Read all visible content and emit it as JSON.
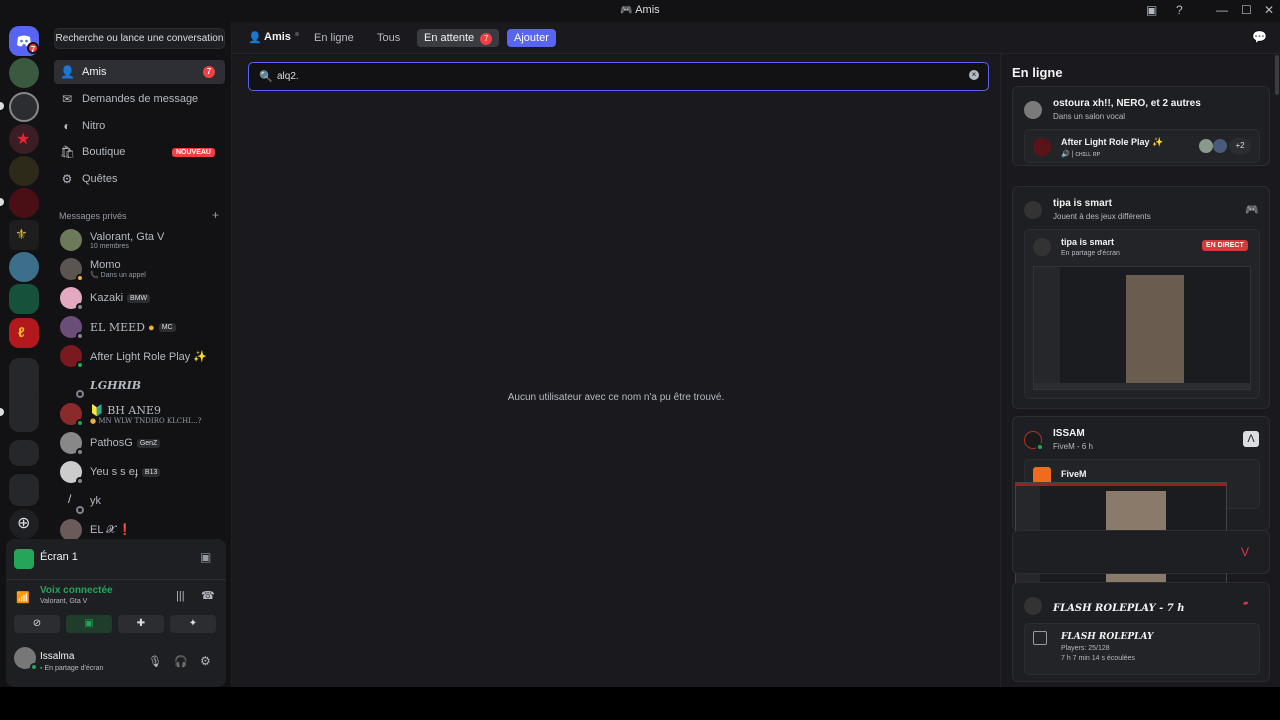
{
  "window": {
    "title": "Amis"
  },
  "sidebar": {
    "search_label": "Recherche ou lance une conversation",
    "nav": [
      {
        "label": "Amis",
        "icon": "friends-icon",
        "badge": "7"
      },
      {
        "label": "Demandes de message",
        "icon": "mail-icon"
      },
      {
        "label": "Nitro",
        "icon": "nitro-icon"
      },
      {
        "label": "Boutique",
        "icon": "shop-icon",
        "badge": "NOUVEAU"
      },
      {
        "label": "Quêtes",
        "icon": "quests-icon"
      }
    ],
    "dm_header": "Messages privés",
    "dms": [
      {
        "name": "Valorant, Gta V",
        "sub": "10 membres"
      },
      {
        "name": "Momo",
        "sub": "Dans un appel"
      },
      {
        "name": "Kazaki",
        "tag": "BMW"
      },
      {
        "name": "EL MEED",
        "tag": "MC"
      },
      {
        "name": "After Light Role Play ✨"
      },
      {
        "name": "LGHRIB"
      },
      {
        "name": "BH ANE9",
        "sub": "MN WLW TNDIRO KLCHI...?"
      },
      {
        "name": "PathosG",
        "tag": "GenZ"
      },
      {
        "name": "Yeu s ѕ eɟ",
        "tag": "B13"
      },
      {
        "name": "yk"
      },
      {
        "name": "EL 𝓧 ❗"
      }
    ]
  },
  "voice_panel": {
    "screen_title": "Écran 1",
    "status": "Voix connectée",
    "channel": "Valorant, Gta V",
    "user_name": "Issalma",
    "user_status": "En partage d'écran"
  },
  "servers": {
    "dm_badge": "7"
  },
  "topbar": {
    "title": "Amis",
    "tabs": [
      "En ligne",
      "Tous"
    ],
    "pending_label": "En attente",
    "pending_count": "7",
    "add_label": "Ajouter"
  },
  "main": {
    "search_value": "alq2.",
    "empty_message": "Aucun utilisateur avec ce nom n'a pu être trouvé."
  },
  "right": {
    "title": "En ligne",
    "cards": [
      {
        "name": "ostoura xh!!, NERO, et 2 autres",
        "sub": "Dans un salon vocal",
        "inner_title": "After Light Role Play ✨",
        "inner_sub": "| ᴄʜɪʟʟ ʀᴘ",
        "extra_count": "+2"
      },
      {
        "name": "tipa is smart",
        "sub": "Jouent à des jeux différents",
        "inner_title": "tipa is smart",
        "inner_sub": "En partage d'écran",
        "live_label": "EN DIRECT"
      },
      {
        "name": "ISSAM",
        "sub": "FiveM - 6 h",
        "inner_title": "FiveM"
      },
      {
        "name": "FLASH ROLEPLAY - 7 h",
        "inner_title": "FLASH ROLEPLAY",
        "line1": "Players: 25/128",
        "line2": "7 h 7 min 14 s écoulées"
      }
    ]
  },
  "colors": {
    "accent": "#5865f2",
    "danger": "#f23f42",
    "online": "#23a55a",
    "background": "#1a1a1e"
  }
}
